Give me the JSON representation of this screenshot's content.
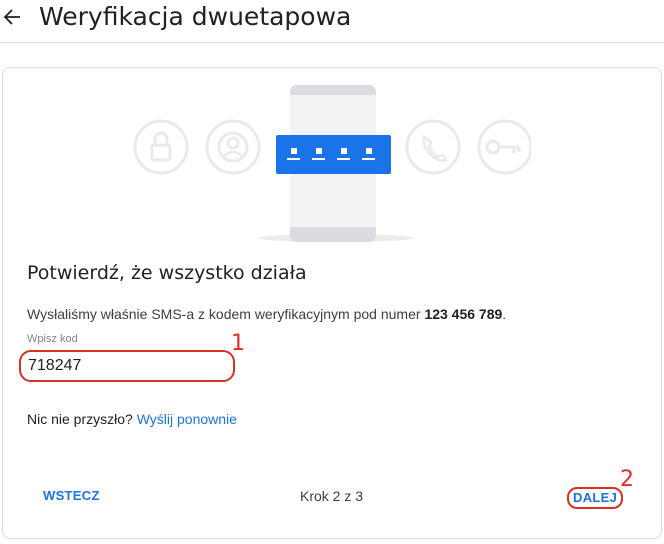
{
  "header": {
    "title": "Weryfikacja dwuetapowa",
    "back_icon": "arrow-back-icon"
  },
  "illustration": {
    "icons": [
      "lock-icon",
      "account-icon",
      "phone-icon",
      "key-icon"
    ],
    "code_dots": 4
  },
  "content": {
    "headline": "Potwierdź, że wszystko działa",
    "sms_prefix": "Wysłaliśmy właśnie SMS-a z kodem weryfikacyjnym pod numer ",
    "phone_number": "123 456 789",
    "sms_suffix": ".",
    "input_label": "Wpisz kod",
    "input_value": "718247",
    "resend_prefix": "Nic nie przyszło? ",
    "resend_link": "Wyślij ponownie"
  },
  "footer": {
    "back_label": "WSTECZ",
    "step_text": "Krok 2 z 3",
    "next_label": "DALEJ"
  },
  "annotations": {
    "marker_1": "1",
    "marker_2": "2"
  },
  "colors": {
    "accent": "#1a73e8",
    "annotation": "#d93025",
    "icon_gray": "#e8eaed"
  }
}
